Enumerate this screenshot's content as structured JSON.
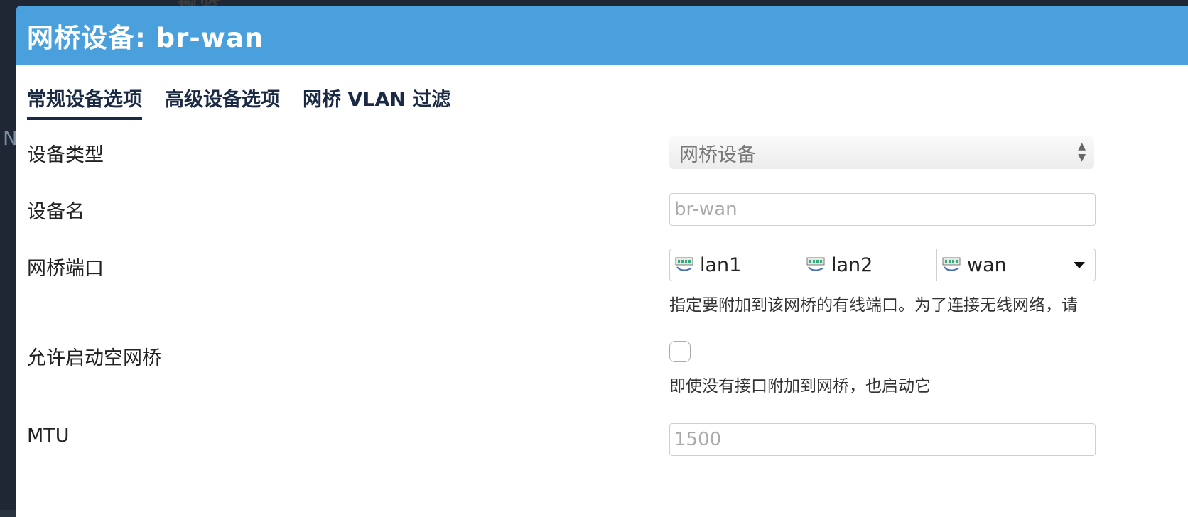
{
  "backdrop": {
    "sidebar_letter": "N",
    "top_text": "概览"
  },
  "modal": {
    "title": "网桥设备: br-wan"
  },
  "tabs": [
    {
      "label": "常规设备选项",
      "active": true
    },
    {
      "label": "高级设备选项",
      "active": false
    },
    {
      "label": "网桥 VLAN 过滤",
      "active": false
    }
  ],
  "form": {
    "device_type": {
      "label": "设备类型",
      "value": "网桥设备"
    },
    "device_name": {
      "label": "设备名",
      "placeholder": "br-wan"
    },
    "bridge_ports": {
      "label": "网桥端口",
      "ports": [
        "lan1",
        "lan2",
        "wan"
      ],
      "description": "指定要附加到该网桥的有线端口。为了连接无线网络，请"
    },
    "empty_bridge": {
      "label": "允许启动空网桥",
      "checked": false,
      "description": "即使没有接口附加到网桥，也启动它"
    },
    "mtu": {
      "label": "MTU",
      "placeholder": "1500"
    }
  },
  "colors": {
    "header": "#4aa0dc",
    "tab_text": "#1b2a44"
  }
}
